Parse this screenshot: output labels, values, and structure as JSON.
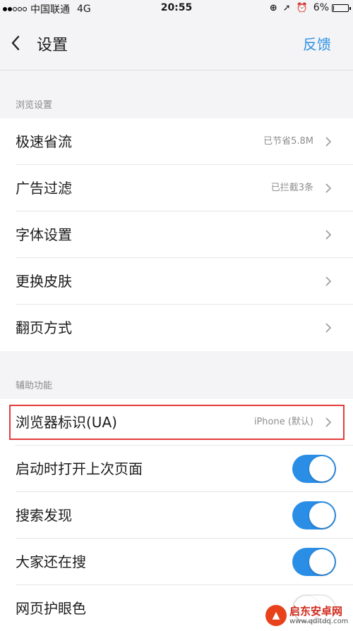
{
  "status_bar": {
    "carrier": "中国联通",
    "network": "4G",
    "time": "20:55",
    "battery_percent": "6%",
    "battery_level": 0.06
  },
  "nav": {
    "title": "设置",
    "feedback_label": "反馈"
  },
  "browse_section": {
    "header": "浏览设置",
    "items": [
      {
        "label": "极速省流",
        "value": "已节省5.8M"
      },
      {
        "label": "广告过滤",
        "value": "已拦截3条"
      },
      {
        "label": "字体设置",
        "value": ""
      },
      {
        "label": "更换皮肤",
        "value": ""
      },
      {
        "label": "翻页方式",
        "value": ""
      }
    ]
  },
  "assist_section": {
    "header": "辅助功能",
    "ua_item": {
      "label": "浏览器标识(UA)",
      "value": "iPhone (默认)"
    },
    "toggles": [
      {
        "label": "启动时打开上次页面",
        "on": true
      },
      {
        "label": "搜索发现",
        "on": true
      },
      {
        "label": "大家还在搜",
        "on": true
      },
      {
        "label": "网页护眼色",
        "on": false
      }
    ]
  },
  "watermark": {
    "title": "启东安卓网",
    "url": "www.qdltdq.com"
  },
  "colors": {
    "accent": "#2b91e3",
    "toggle_on": "#2b8ee6",
    "highlight": "#e53b3b"
  }
}
